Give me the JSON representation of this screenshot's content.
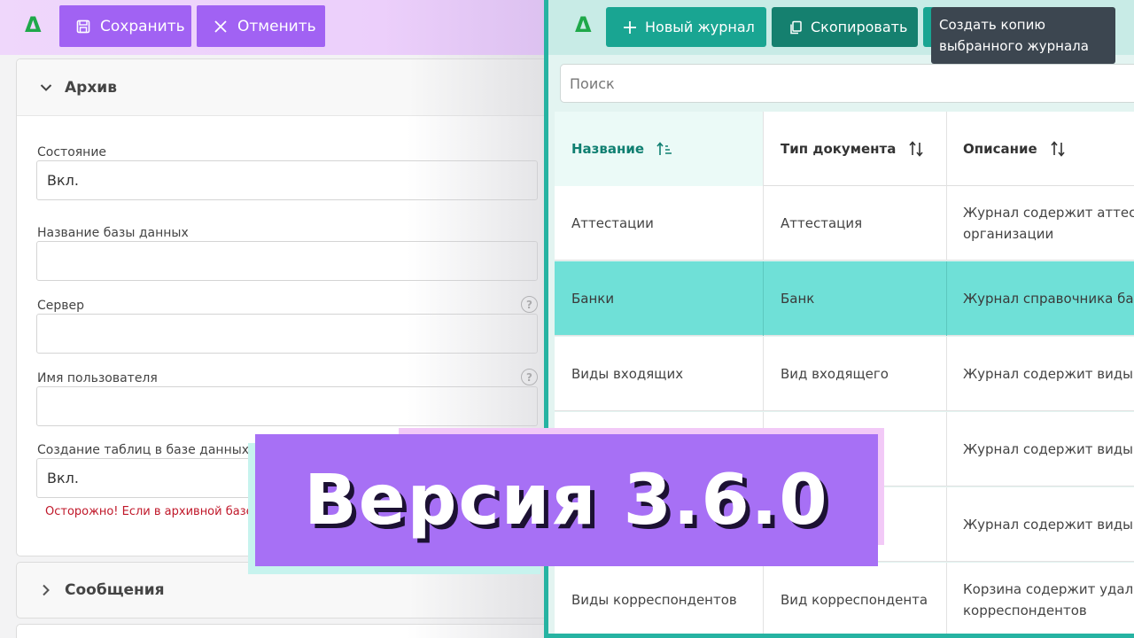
{
  "left_panel": {
    "logo": "Δ",
    "toolbar": {
      "save_label": "Сохранить",
      "cancel_label": "Отменить"
    },
    "archive_section": {
      "title": "Архив",
      "fields": {
        "state": {
          "label": "Состояние",
          "value": "Вкл."
        },
        "db_name": {
          "label": "Название базы данных",
          "value": ""
        },
        "server": {
          "label": "Сервер",
          "value": ""
        },
        "username": {
          "label": "Имя пользователя",
          "value": ""
        },
        "create_tables": {
          "label": "Создание таблиц в базе данных",
          "value": "Вкл."
        }
      },
      "warning": "Осторожно! Если в архивной базе с"
    },
    "messages_section": {
      "title": "Сообщения"
    }
  },
  "right_panel": {
    "logo": "Δ",
    "toolbar": {
      "new_journal_label": "Новый журнал",
      "copy_label": "Скопировать"
    },
    "tooltip": {
      "line1": "Создать копию",
      "line2": "выбранного журнала"
    },
    "search": {
      "placeholder": "Поиск"
    },
    "table": {
      "columns": [
        "Название",
        "Тип документа",
        "Описание"
      ],
      "rows": [
        {
          "name": "Аттестации",
          "type": "Аттестация",
          "desc1": "Журнал содержит аттест",
          "desc2": "организации"
        },
        {
          "name": "Банки",
          "type": "Банк",
          "desc1": "Журнал справочника ба",
          "desc2": ""
        },
        {
          "name": "Виды входящих",
          "type": "Вид входящего",
          "desc1": "Журнал содержит виды",
          "desc2": ""
        },
        {
          "name": "",
          "type": "",
          "desc1": "Журнал содержит виды",
          "desc2": ""
        },
        {
          "name": "",
          "type": "",
          "desc1": "Журнал содержит виды",
          "desc2": ""
        },
        {
          "name": "Виды корреспондентов",
          "type": "Вид корреспондента",
          "desc1": "Корзина содержит удале",
          "desc2": "корреспондентов"
        }
      ],
      "selected_row": 1
    }
  },
  "banner": {
    "text": "Версия 3.6.0"
  },
  "colors": {
    "purple": "#a162f3",
    "teal": "#19a592",
    "selected_row": "#6fe0d7",
    "logo_green": "#1fa84a"
  }
}
